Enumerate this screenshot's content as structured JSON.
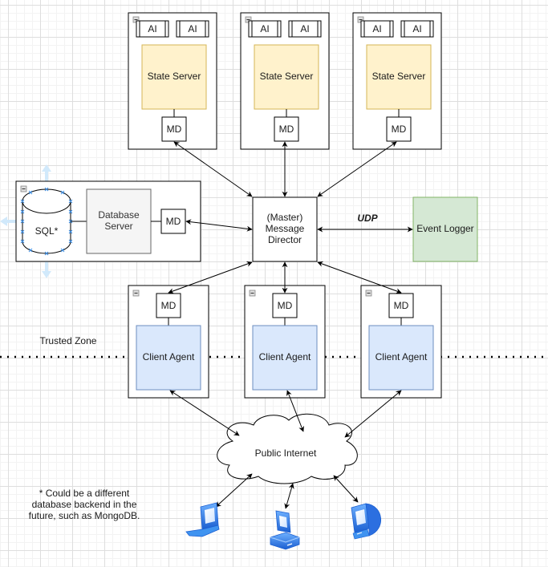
{
  "diagram": {
    "state_server_groups": [
      {
        "ai_labels": [
          "AI",
          "AI"
        ],
        "server_label": "State Server",
        "md_label": "MD"
      },
      {
        "ai_labels": [
          "AI",
          "AI"
        ],
        "server_label": "State Server",
        "md_label": "MD"
      },
      {
        "ai_labels": [
          "AI",
          "AI"
        ],
        "server_label": "State Server",
        "md_label": "MD"
      }
    ],
    "database_group": {
      "db_label": "SQL*",
      "server_label": [
        "Database",
        "Server"
      ],
      "md_label": "MD"
    },
    "master_md": {
      "label_lines": [
        "(Master)",
        "Message",
        "Director"
      ]
    },
    "udp_label": "UDP",
    "event_logger": {
      "label": "Event Logger"
    },
    "client_groups": [
      {
        "md_label": "MD",
        "agent_label": "Client Agent"
      },
      {
        "md_label": "MD",
        "agent_label": "Client Agent"
      },
      {
        "md_label": "MD",
        "agent_label": "Client Agent"
      }
    ],
    "trusted_zone_label": "Trusted Zone",
    "internet_label": "Public Internet",
    "footnote_lines": [
      "* Could be a different",
      "database backend in the",
      "future, such as MongoDB."
    ],
    "devices": [
      "laptop-icon",
      "desktop-icon",
      "imac-icon"
    ],
    "colors": {
      "state_server_fill": "#fff2cc",
      "state_server_stroke": "#d6b656",
      "client_agent_fill": "#dae8fc",
      "client_agent_stroke": "#6c8ebf",
      "event_logger_fill": "#d5e8d4",
      "event_logger_stroke": "#82b366",
      "db_server_fill": "#f5f5f5",
      "db_server_stroke": "#666666",
      "device_blue": "#2f7fe6"
    }
  }
}
